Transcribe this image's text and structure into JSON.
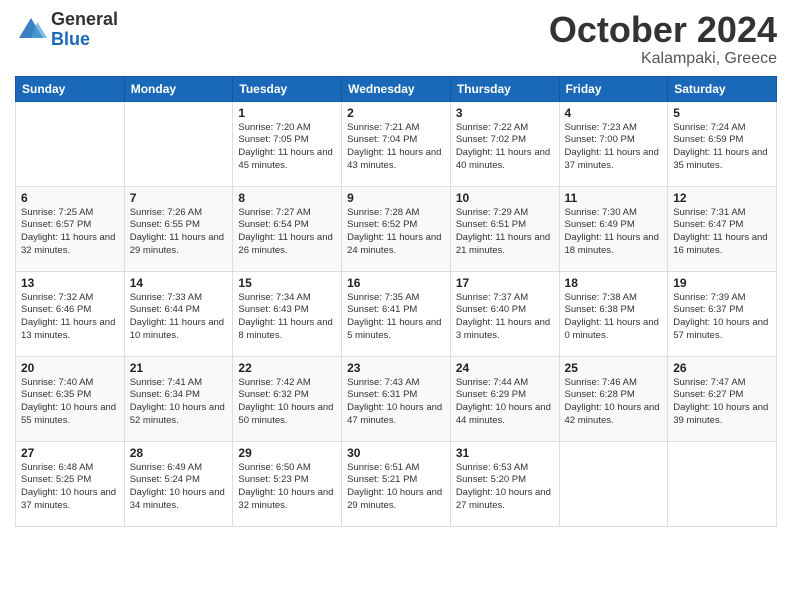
{
  "header": {
    "logo_general": "General",
    "logo_blue": "Blue",
    "month": "October 2024",
    "location": "Kalampaki, Greece"
  },
  "weekdays": [
    "Sunday",
    "Monday",
    "Tuesday",
    "Wednesday",
    "Thursday",
    "Friday",
    "Saturday"
  ],
  "weeks": [
    [
      {
        "day": "",
        "sunrise": "",
        "sunset": "",
        "daylight": ""
      },
      {
        "day": "",
        "sunrise": "",
        "sunset": "",
        "daylight": ""
      },
      {
        "day": "1",
        "sunrise": "Sunrise: 7:20 AM",
        "sunset": "Sunset: 7:05 PM",
        "daylight": "Daylight: 11 hours and 45 minutes."
      },
      {
        "day": "2",
        "sunrise": "Sunrise: 7:21 AM",
        "sunset": "Sunset: 7:04 PM",
        "daylight": "Daylight: 11 hours and 43 minutes."
      },
      {
        "day": "3",
        "sunrise": "Sunrise: 7:22 AM",
        "sunset": "Sunset: 7:02 PM",
        "daylight": "Daylight: 11 hours and 40 minutes."
      },
      {
        "day": "4",
        "sunrise": "Sunrise: 7:23 AM",
        "sunset": "Sunset: 7:00 PM",
        "daylight": "Daylight: 11 hours and 37 minutes."
      },
      {
        "day": "5",
        "sunrise": "Sunrise: 7:24 AM",
        "sunset": "Sunset: 6:59 PM",
        "daylight": "Daylight: 11 hours and 35 minutes."
      }
    ],
    [
      {
        "day": "6",
        "sunrise": "Sunrise: 7:25 AM",
        "sunset": "Sunset: 6:57 PM",
        "daylight": "Daylight: 11 hours and 32 minutes."
      },
      {
        "day": "7",
        "sunrise": "Sunrise: 7:26 AM",
        "sunset": "Sunset: 6:55 PM",
        "daylight": "Daylight: 11 hours and 29 minutes."
      },
      {
        "day": "8",
        "sunrise": "Sunrise: 7:27 AM",
        "sunset": "Sunset: 6:54 PM",
        "daylight": "Daylight: 11 hours and 26 minutes."
      },
      {
        "day": "9",
        "sunrise": "Sunrise: 7:28 AM",
        "sunset": "Sunset: 6:52 PM",
        "daylight": "Daylight: 11 hours and 24 minutes."
      },
      {
        "day": "10",
        "sunrise": "Sunrise: 7:29 AM",
        "sunset": "Sunset: 6:51 PM",
        "daylight": "Daylight: 11 hours and 21 minutes."
      },
      {
        "day": "11",
        "sunrise": "Sunrise: 7:30 AM",
        "sunset": "Sunset: 6:49 PM",
        "daylight": "Daylight: 11 hours and 18 minutes."
      },
      {
        "day": "12",
        "sunrise": "Sunrise: 7:31 AM",
        "sunset": "Sunset: 6:47 PM",
        "daylight": "Daylight: 11 hours and 16 minutes."
      }
    ],
    [
      {
        "day": "13",
        "sunrise": "Sunrise: 7:32 AM",
        "sunset": "Sunset: 6:46 PM",
        "daylight": "Daylight: 11 hours and 13 minutes."
      },
      {
        "day": "14",
        "sunrise": "Sunrise: 7:33 AM",
        "sunset": "Sunset: 6:44 PM",
        "daylight": "Daylight: 11 hours and 10 minutes."
      },
      {
        "day": "15",
        "sunrise": "Sunrise: 7:34 AM",
        "sunset": "Sunset: 6:43 PM",
        "daylight": "Daylight: 11 hours and 8 minutes."
      },
      {
        "day": "16",
        "sunrise": "Sunrise: 7:35 AM",
        "sunset": "Sunset: 6:41 PM",
        "daylight": "Daylight: 11 hours and 5 minutes."
      },
      {
        "day": "17",
        "sunrise": "Sunrise: 7:37 AM",
        "sunset": "Sunset: 6:40 PM",
        "daylight": "Daylight: 11 hours and 3 minutes."
      },
      {
        "day": "18",
        "sunrise": "Sunrise: 7:38 AM",
        "sunset": "Sunset: 6:38 PM",
        "daylight": "Daylight: 11 hours and 0 minutes."
      },
      {
        "day": "19",
        "sunrise": "Sunrise: 7:39 AM",
        "sunset": "Sunset: 6:37 PM",
        "daylight": "Daylight: 10 hours and 57 minutes."
      }
    ],
    [
      {
        "day": "20",
        "sunrise": "Sunrise: 7:40 AM",
        "sunset": "Sunset: 6:35 PM",
        "daylight": "Daylight: 10 hours and 55 minutes."
      },
      {
        "day": "21",
        "sunrise": "Sunrise: 7:41 AM",
        "sunset": "Sunset: 6:34 PM",
        "daylight": "Daylight: 10 hours and 52 minutes."
      },
      {
        "day": "22",
        "sunrise": "Sunrise: 7:42 AM",
        "sunset": "Sunset: 6:32 PM",
        "daylight": "Daylight: 10 hours and 50 minutes."
      },
      {
        "day": "23",
        "sunrise": "Sunrise: 7:43 AM",
        "sunset": "Sunset: 6:31 PM",
        "daylight": "Daylight: 10 hours and 47 minutes."
      },
      {
        "day": "24",
        "sunrise": "Sunrise: 7:44 AM",
        "sunset": "Sunset: 6:29 PM",
        "daylight": "Daylight: 10 hours and 44 minutes."
      },
      {
        "day": "25",
        "sunrise": "Sunrise: 7:46 AM",
        "sunset": "Sunset: 6:28 PM",
        "daylight": "Daylight: 10 hours and 42 minutes."
      },
      {
        "day": "26",
        "sunrise": "Sunrise: 7:47 AM",
        "sunset": "Sunset: 6:27 PM",
        "daylight": "Daylight: 10 hours and 39 minutes."
      }
    ],
    [
      {
        "day": "27",
        "sunrise": "Sunrise: 6:48 AM",
        "sunset": "Sunset: 5:25 PM",
        "daylight": "Daylight: 10 hours and 37 minutes."
      },
      {
        "day": "28",
        "sunrise": "Sunrise: 6:49 AM",
        "sunset": "Sunset: 5:24 PM",
        "daylight": "Daylight: 10 hours and 34 minutes."
      },
      {
        "day": "29",
        "sunrise": "Sunrise: 6:50 AM",
        "sunset": "Sunset: 5:23 PM",
        "daylight": "Daylight: 10 hours and 32 minutes."
      },
      {
        "day": "30",
        "sunrise": "Sunrise: 6:51 AM",
        "sunset": "Sunset: 5:21 PM",
        "daylight": "Daylight: 10 hours and 29 minutes."
      },
      {
        "day": "31",
        "sunrise": "Sunrise: 6:53 AM",
        "sunset": "Sunset: 5:20 PM",
        "daylight": "Daylight: 10 hours and 27 minutes."
      },
      {
        "day": "",
        "sunrise": "",
        "sunset": "",
        "daylight": ""
      },
      {
        "day": "",
        "sunrise": "",
        "sunset": "",
        "daylight": ""
      }
    ]
  ]
}
